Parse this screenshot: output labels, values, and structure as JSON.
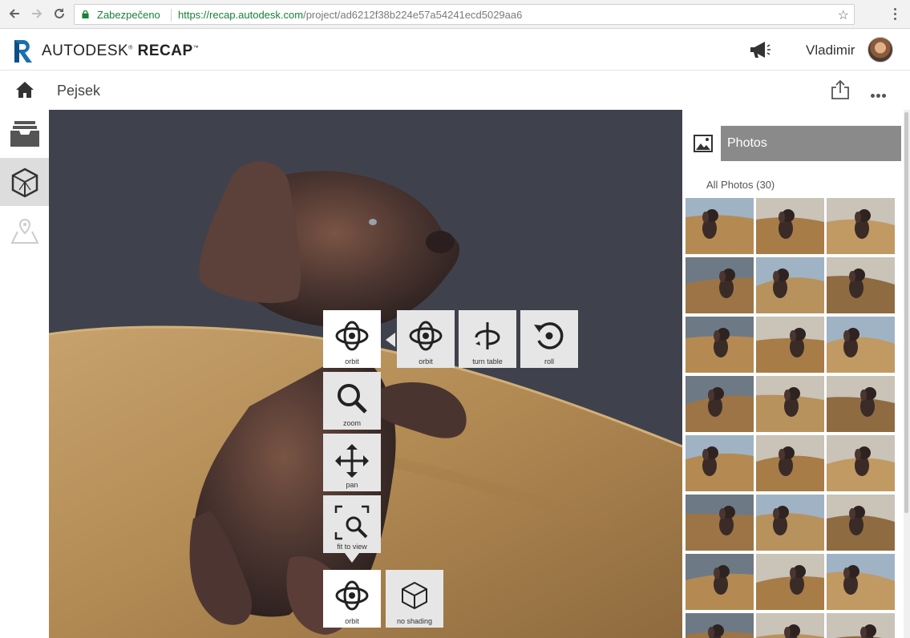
{
  "browser": {
    "back_icon": "arrow-left-icon",
    "forward_icon": "arrow-right-icon",
    "reload_icon": "reload-icon",
    "secure_label": "Zabezpečeno",
    "url_host": "https://recap.autodesk.com",
    "url_path": "/project/ad6212f38b224e57a54241ecd5029aa6"
  },
  "header": {
    "brand_light": "AUTODESK",
    "brand_bold": "RECAP",
    "username": "Vladimir"
  },
  "project": {
    "title": "Pejsek"
  },
  "toolbar": {
    "orbit_label": "orbit",
    "zoom_label": "zoom",
    "pan_label": "pan",
    "fit_label": "fit to view",
    "orbit2_label": "orbit",
    "turntable_label": "turn table",
    "roll_label": "roll",
    "orbit_bottom_label": "orbit",
    "shading_label": "no shading"
  },
  "panel": {
    "tab_label": "Photos",
    "all_photos": "All Photos (30)",
    "photo_count": 30
  },
  "colors": {
    "viewport_bg": "#3f424c",
    "table": "#b28b55",
    "panel_tab": "#8a8a8a",
    "secure_green": "#188038"
  }
}
